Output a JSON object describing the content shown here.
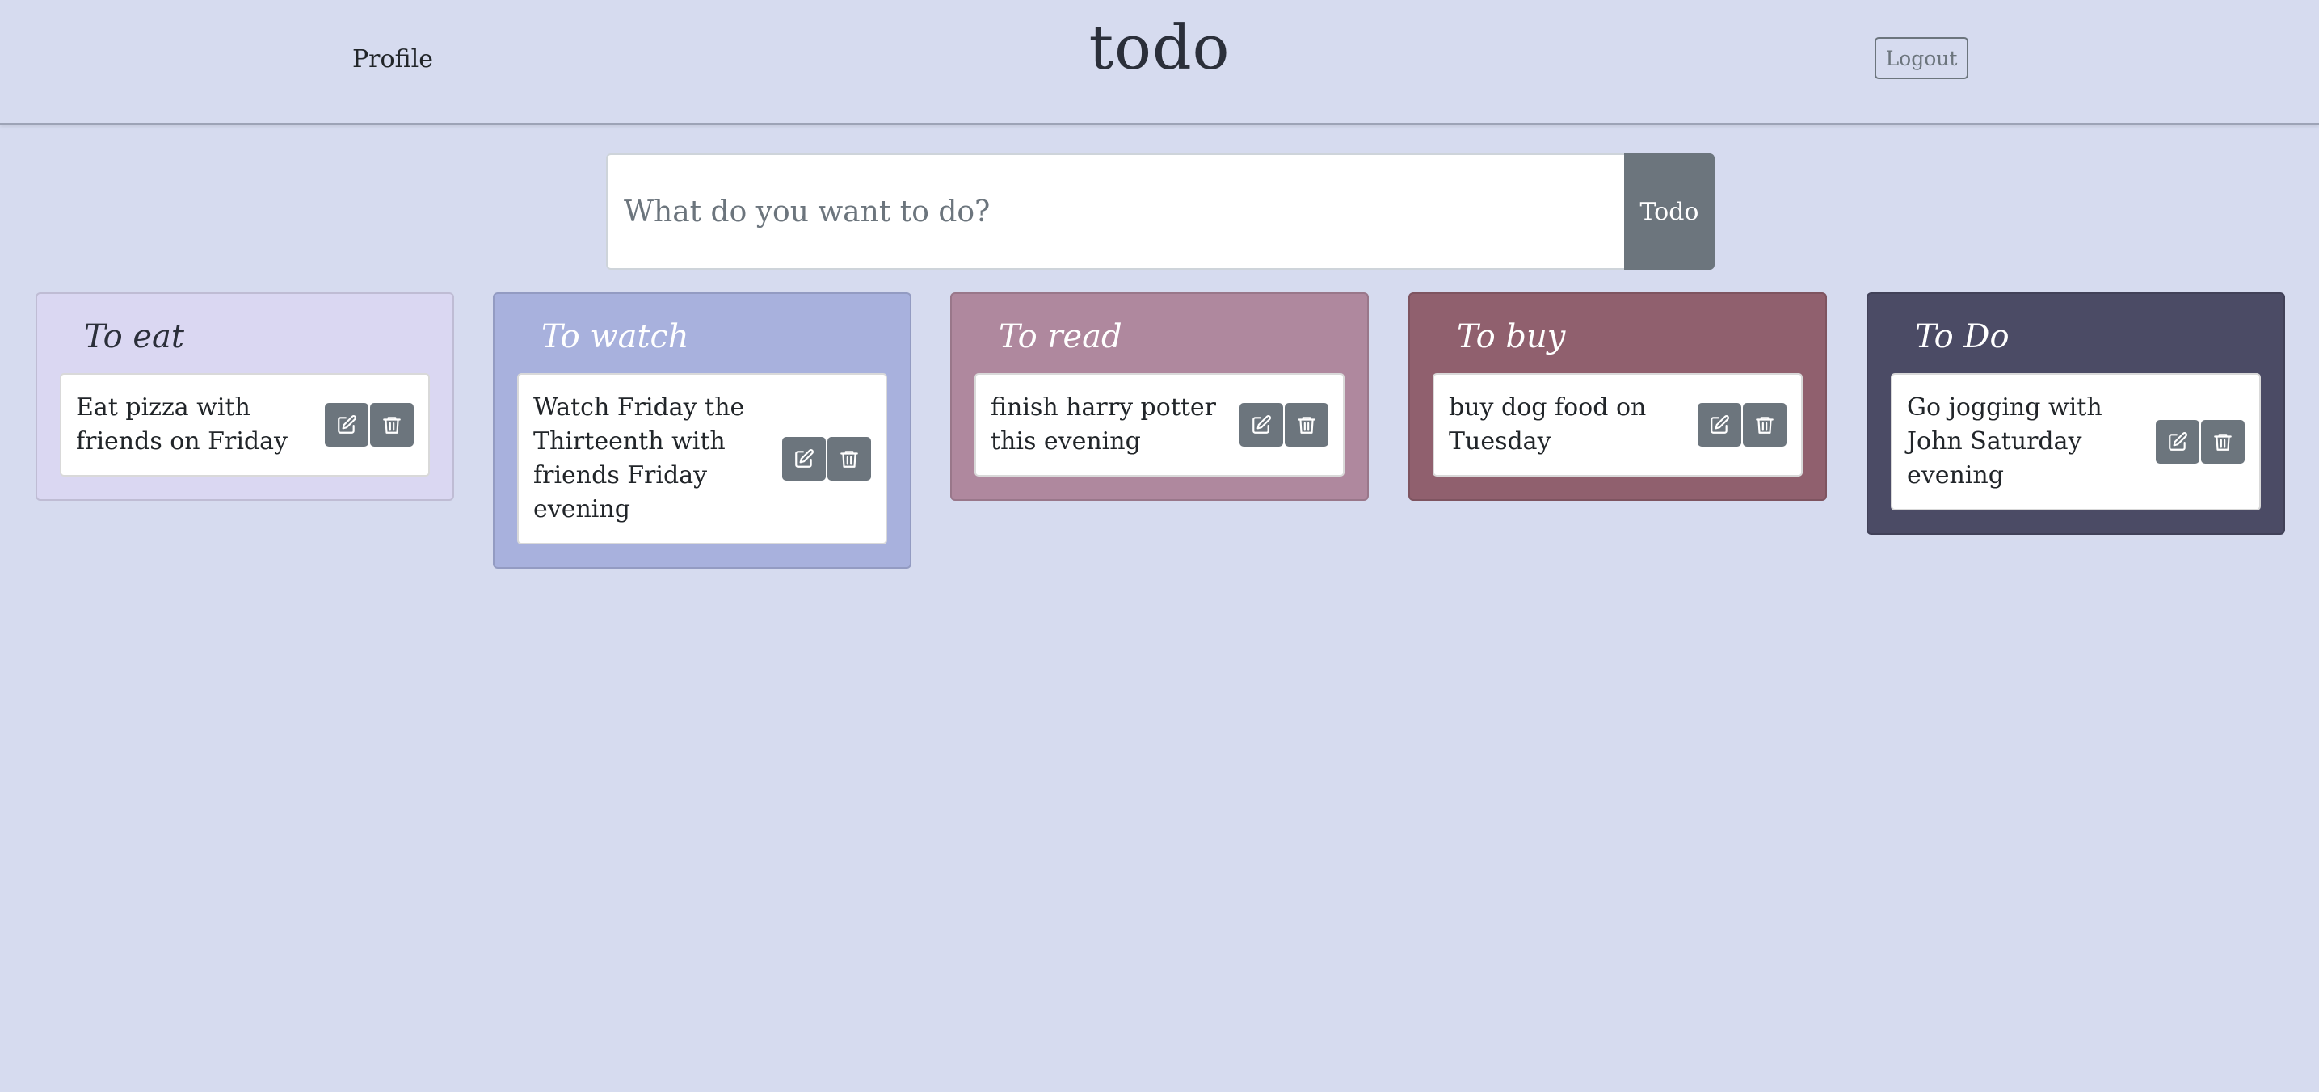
{
  "header": {
    "profile_label": "Profile",
    "title": "todo",
    "logout_label": "Logout"
  },
  "new_todo": {
    "placeholder": "What do you want to do?",
    "value": "",
    "submit_label": "Todo"
  },
  "columns": [
    {
      "title": "To eat",
      "background": "#dad7f2",
      "title_color": "#2b2f3a",
      "items": [
        {
          "text": "Eat pizza with friends on Friday"
        }
      ]
    },
    {
      "title": "To watch",
      "background": "#a8b1dd",
      "title_color": "#ffffff",
      "items": [
        {
          "text": "Watch Friday the Thirteenth with friends Friday evening"
        }
      ]
    },
    {
      "title": "To read",
      "background": "#af889e",
      "title_color": "#ffffff",
      "items": [
        {
          "text": "finish harry potter this evening"
        }
      ]
    },
    {
      "title": "To buy",
      "background": "#90606e",
      "title_color": "#ffffff",
      "items": [
        {
          "text": "buy dog food on Tuesday"
        }
      ]
    },
    {
      "title": "To Do",
      "background": "#4b4b65",
      "title_color": "#ffffff",
      "items": [
        {
          "text": "Go jogging with John Saturday evening"
        }
      ]
    }
  ],
  "icons": {
    "edit": "edit-icon",
    "delete": "trash-icon"
  },
  "colors": {
    "page_background": "#d6dbef",
    "button_secondary": "#6c757d"
  }
}
